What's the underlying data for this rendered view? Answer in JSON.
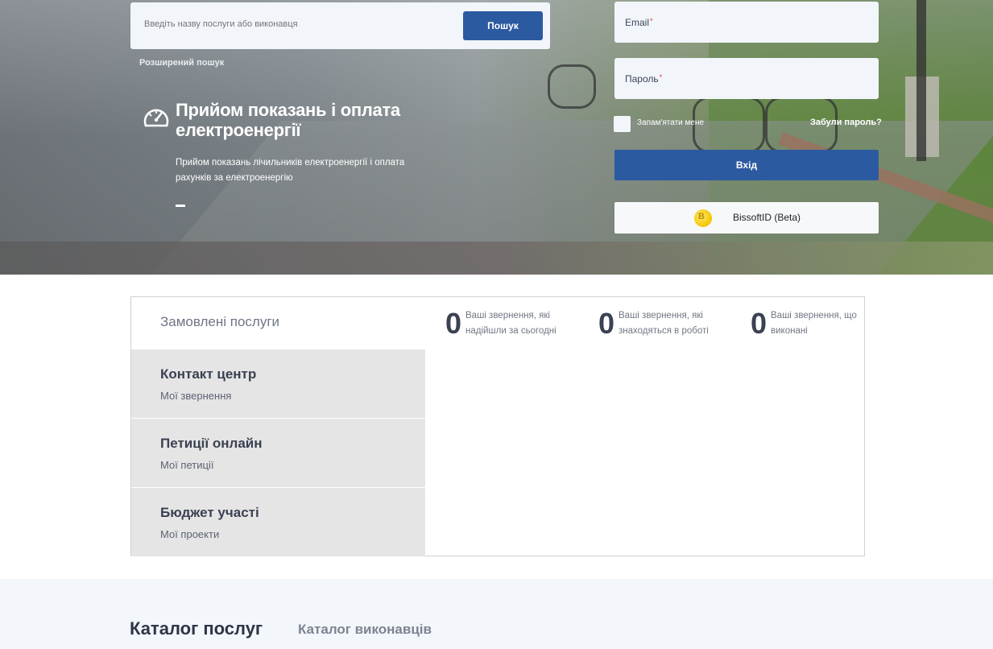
{
  "search": {
    "placeholder": "Введіть назву послуги або виконавця",
    "button_label": "Пошук",
    "advanced_link": "Розширений пошук"
  },
  "promo": {
    "icon": "speedometer-icon",
    "title": "Прийом показань і оплата електроенергії",
    "description": "Прийом показань лічильників електроенергії і оплата рахунків за електроенергію"
  },
  "login": {
    "email_label": "Email",
    "password_label": "Пароль",
    "required_mark": "*",
    "remember_label": "Запам'ятати мене",
    "forgot_link": "Забули пароль?",
    "login_button": "Вхід",
    "bissoft_button": "BissoftID (Beta)",
    "bissoft_logo_letter": "B"
  },
  "services": {
    "title": "Замовлені послуги",
    "items": [
      {
        "title": "Контакт центр",
        "subtitle": "Мої звернення"
      },
      {
        "title": "Петиції онлайн",
        "subtitle": "Мої петиції"
      },
      {
        "title": "Бюджет участі",
        "subtitle": "Мої проекти"
      }
    ],
    "stats": [
      {
        "value": "0",
        "label": "Ваші звернення, які надійшли за сьогодні"
      },
      {
        "value": "0",
        "label": "Ваші звернення, які знаходяться в роботі"
      },
      {
        "value": "0",
        "label": "Ваші звернення, що виконані"
      }
    ]
  },
  "catalog": {
    "tabs": [
      {
        "label": "Каталог послуг",
        "active": true
      },
      {
        "label": "Каталог виконавців",
        "active": false
      }
    ]
  },
  "colors": {
    "primary": "#2c5aa0",
    "menu_bg": "#e5e5e5",
    "page_bg": "#f3f6fa"
  }
}
